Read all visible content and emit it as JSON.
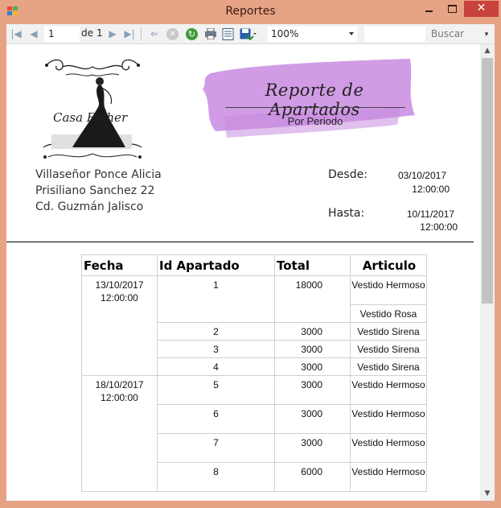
{
  "window": {
    "title": "Reportes",
    "close_glyph": "✕"
  },
  "toolbar": {
    "first_icon": "first-page-icon",
    "prev_icon": "previous-page-icon",
    "page_current": "1",
    "page_of": "de",
    "page_total": "1",
    "next_icon": "next-page-icon",
    "last_icon": "last-page-icon",
    "zoom_value": "100%",
    "find_label": "Buscar"
  },
  "report": {
    "logo_text": "Casa Esther",
    "title": "Reporte de Apartados",
    "subtitle": "Por Periodo",
    "address": [
      "Villaseñor Ponce Alicia",
      "Prisiliano Sanchez 22",
      "Cd. Guzmán Jalisco"
    ],
    "from_label": "Desde:",
    "from_date": "03/10/2017",
    "from_time": "12:00:00",
    "to_label": "Hasta:",
    "to_date": "10/11/2017",
    "to_time": "12:00:00",
    "accent_color": "#c98be0",
    "columns": [
      "Fecha",
      "Id Apartado",
      "Total",
      "Articulo"
    ],
    "groups": [
      {
        "date": "13/10/2017",
        "time": "12:00:00",
        "orders": [
          {
            "id": "1",
            "total": "18000",
            "articles": [
              "Vestido Hermoso",
              "Vestido Rosa"
            ]
          },
          {
            "id": "2",
            "total": "3000",
            "articles": [
              "Vestido Sirena"
            ]
          },
          {
            "id": "3",
            "total": "3000",
            "articles": [
              "Vestido Sirena"
            ]
          },
          {
            "id": "4",
            "total": "3000",
            "articles": [
              "Vestido Sirena"
            ]
          }
        ]
      },
      {
        "date": "18/10/2017",
        "time": "12:00:00",
        "orders": [
          {
            "id": "5",
            "total": "3000",
            "articles": [
              "Vestido Hermoso"
            ]
          },
          {
            "id": "6",
            "total": "3000",
            "articles": [
              "Vestido Hermoso"
            ]
          },
          {
            "id": "7",
            "total": "3000",
            "articles": [
              "Vestido Hermoso"
            ]
          },
          {
            "id": "8",
            "total": "6000",
            "articles": [
              "Vestido Hermoso"
            ]
          }
        ]
      }
    ]
  }
}
